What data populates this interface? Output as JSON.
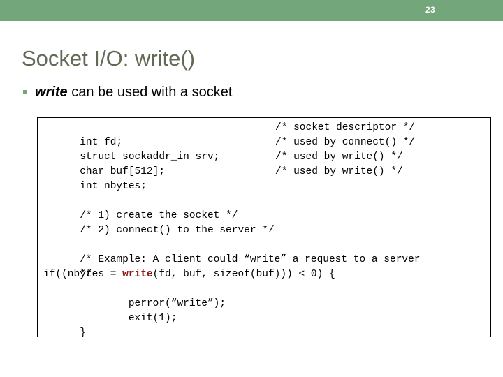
{
  "slide": {
    "number": "23",
    "title": "Socket I/O: write()",
    "accent_color": "#74a67c",
    "title_color": "#626a56",
    "highlight_color": "#8c1515"
  },
  "bullet": {
    "keyword": "write",
    "rest": " can be used with a socket"
  },
  "code": {
    "lines": [
      {
        "main": "int fd;",
        "comment": "/* socket descriptor */"
      },
      {
        "main": "struct sockaddr_in srv;",
        "comment": "/* used by connect() */"
      },
      {
        "main": "char buf[512];",
        "comment": "/* used by write() */"
      },
      {
        "main": "int nbytes;",
        "comment": "/* used by write() */"
      },
      {
        "main": "",
        "comment": ""
      },
      {
        "main": "/* 1) create the socket */",
        "comment": ""
      },
      {
        "main": "/* 2) connect() to the server */",
        "comment": ""
      },
      {
        "main": "",
        "comment": ""
      },
      {
        "main": "/* Example: A client could “write” a request to a server",
        "comment": ""
      },
      {
        "main": "*/",
        "comment": ""
      }
    ],
    "if_line": {
      "before": "if((nbytes = ",
      "keyword": "write",
      "after": "(fd, buf, sizeof(buf))) < 0) {"
    },
    "tail_lines": [
      "        perror(“write”);",
      "        exit(1);",
      "}"
    ]
  }
}
